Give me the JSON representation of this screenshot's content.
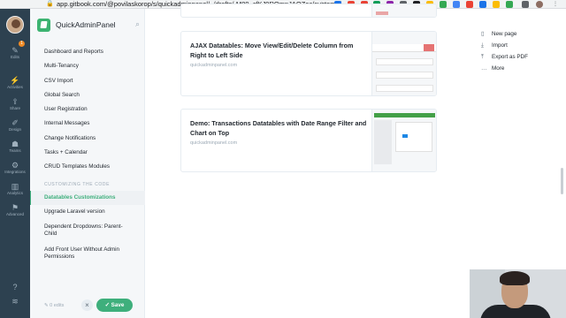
{
  "browser": {
    "url": "app.gitbook.com/@povilaskorop/s/quickadminpanel/~/drafts/-M89_cfKJ9ROmnJAOZac/customizi..."
  },
  "rail": {
    "items": [
      {
        "label": "Edits",
        "icon": "edit-icon",
        "glyph": "✎"
      },
      {
        "label": "Activities",
        "icon": "activity-icon",
        "glyph": "⚡"
      },
      {
        "label": "Share",
        "icon": "share-icon",
        "glyph": "⇪"
      },
      {
        "label": "Design",
        "icon": "design-icon",
        "glyph": "✐"
      },
      {
        "label": "Teams",
        "icon": "teams-icon",
        "glyph": "☗"
      },
      {
        "label": "Integrations",
        "icon": "integrations-icon",
        "glyph": "⚙"
      },
      {
        "label": "Analytics",
        "icon": "analytics-icon",
        "glyph": "▥"
      },
      {
        "label": "Advanced",
        "icon": "advanced-icon",
        "glyph": "⚑"
      }
    ],
    "badge": "1",
    "help_glyph": "?"
  },
  "sidebar": {
    "title": "QuickAdminPanel",
    "items": [
      "Dashboard and Reports",
      "Multi-Tenancy",
      "CSV Import",
      "Global Search",
      "User Registration",
      "Internal Messages",
      "Change Notifications",
      "Tasks + Calendar",
      "CRUD Templates Modules"
    ],
    "section_title": "CUSTOMIZING THE CODE",
    "section_items": [
      "Datatables Customizations",
      "Upgrade Laravel version",
      "Dependent Dropdowns: Parent-Child",
      "Add Front User Without Admin Permissions"
    ],
    "edits_label": "0 edits",
    "save_label": "Save"
  },
  "main": {
    "cards": [
      {
        "title": "AJAX Datatables: Move View/Edit/Delete Column from Right to Left Side",
        "host": "quickadminpanel.com"
      },
      {
        "title": "Demo: Transactions Datatables with Date Range Filter and Chart on Top",
        "host": "quickadminpanel.com"
      }
    ]
  },
  "right_menu": [
    {
      "label": "New page",
      "icon": "new-page-icon",
      "glyph": "▯"
    },
    {
      "label": "Import",
      "icon": "import-icon",
      "glyph": "⤓"
    },
    {
      "label": "Export as PDF",
      "icon": "export-icon",
      "glyph": "⤒"
    },
    {
      "label": "More",
      "icon": "more-icon",
      "glyph": "…"
    }
  ],
  "colors": {
    "accent": "#3eaf7c",
    "rail_bg": "#2d4150",
    "sidebar_bg": "#f5f7f9"
  }
}
